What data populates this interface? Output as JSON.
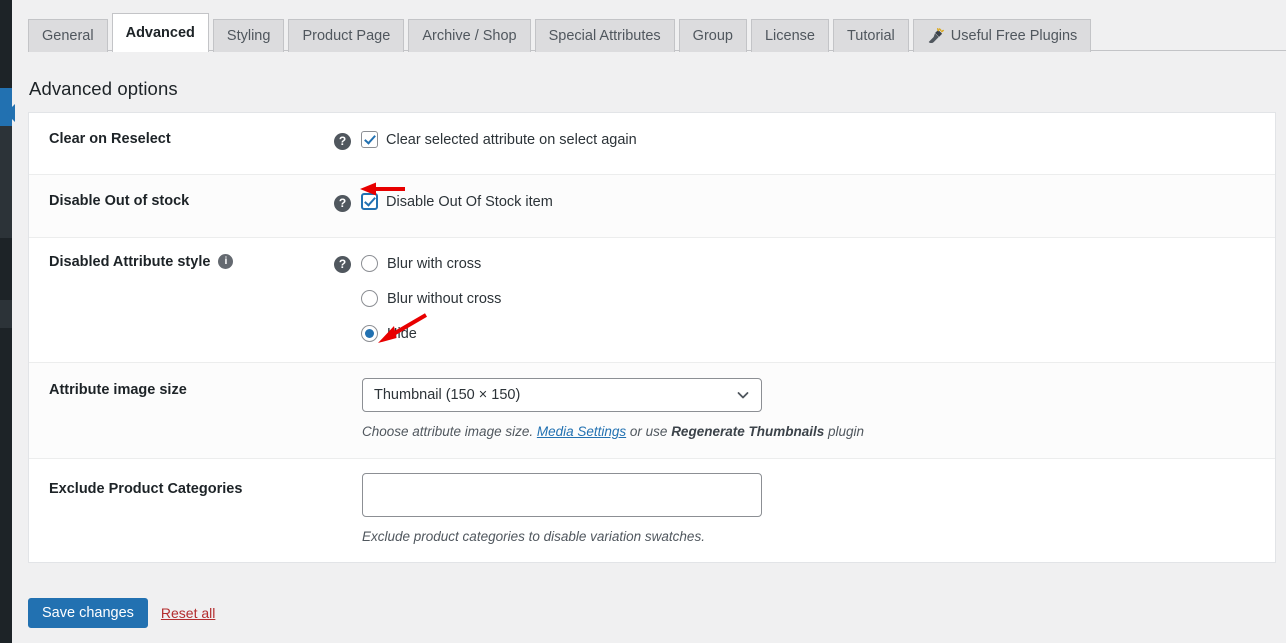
{
  "tabs": [
    {
      "label": "General",
      "active": false,
      "icon": null
    },
    {
      "label": "Advanced",
      "active": true,
      "icon": null
    },
    {
      "label": "Styling",
      "active": false,
      "icon": null
    },
    {
      "label": "Product Page",
      "active": false,
      "icon": null
    },
    {
      "label": "Archive / Shop",
      "active": false,
      "icon": null
    },
    {
      "label": "Special Attributes",
      "active": false,
      "icon": null
    },
    {
      "label": "Group",
      "active": false,
      "icon": null
    },
    {
      "label": "License",
      "active": false,
      "icon": null
    },
    {
      "label": "Tutorial",
      "active": false,
      "icon": null
    },
    {
      "label": "Useful Free Plugins",
      "active": false,
      "icon": "plug-icon"
    }
  ],
  "page": {
    "heading": "Advanced options"
  },
  "icons": {
    "help": "?",
    "info": "i"
  },
  "rows": {
    "clear_on_reselect": {
      "label": "Clear on Reselect",
      "checkbox_label": "Clear selected attribute on select again",
      "checked": true
    },
    "disable_out_of_stock": {
      "label": "Disable Out of stock",
      "checkbox_label": "Disable Out Of Stock item",
      "checked": true
    },
    "disabled_attribute_style": {
      "label": "Disabled Attribute style",
      "options": [
        {
          "label": "Blur with cross",
          "selected": false
        },
        {
          "label": "Blur without cross",
          "selected": false
        },
        {
          "label": "Hide",
          "selected": true
        }
      ]
    },
    "attribute_image_size": {
      "label": "Attribute image size",
      "selected_value": "Thumbnail (150 × 150)",
      "description_prefix": "Choose attribute image size. ",
      "description_link": "Media Settings",
      "description_mid": " or use ",
      "description_strong": "Regenerate Thumbnails",
      "description_suffix": " plugin"
    },
    "exclude_product_categories": {
      "label": "Exclude Product Categories",
      "value": "",
      "placeholder": "",
      "description": "Exclude product categories to disable variation swatches."
    }
  },
  "footer": {
    "save_label": "Save changes",
    "reset_label": "Reset all"
  },
  "colors": {
    "accent": "#2271b1",
    "reset_link": "#b32d2e",
    "annotation": "#e80000",
    "sidebar": "#1d2327",
    "page_bg": "#f0f0f1"
  }
}
